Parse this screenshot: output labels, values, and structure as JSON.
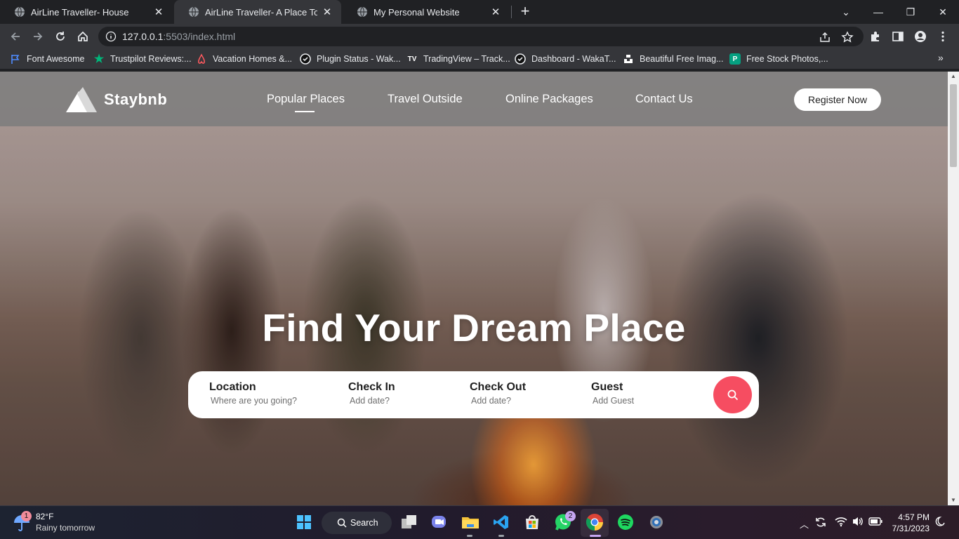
{
  "browser": {
    "tabs": [
      {
        "title": "AirLine Traveller- House",
        "active": false
      },
      {
        "title": "AirLine Traveller- A Place To Choose",
        "active": true
      },
      {
        "title": "My Personal Website",
        "active": false
      }
    ],
    "url_host": "127.0.0.1",
    "url_rest": ":5503/index.html",
    "bookmarks": [
      {
        "label": "Font Awesome",
        "icon": "flag-icon"
      },
      {
        "label": "Trustpilot Reviews:...",
        "icon": "star-icon"
      },
      {
        "label": "Vacation Homes &...",
        "icon": "airbnb-icon"
      },
      {
        "label": "Plugin Status - Wak...",
        "icon": "check-circle-icon"
      },
      {
        "label": "TradingView – Track...",
        "icon": "tradingview-icon"
      },
      {
        "label": "Dashboard - WakaT...",
        "icon": "check-circle-icon"
      },
      {
        "label": "Beautiful Free Imag...",
        "icon": "unsplash-icon"
      },
      {
        "label": "Free Stock Photos,...",
        "icon": "pexels-icon"
      }
    ]
  },
  "site": {
    "brand": "Staybnb",
    "nav": [
      {
        "label": "Popular Places",
        "active": true
      },
      {
        "label": "Travel Outside",
        "active": false
      },
      {
        "label": "Online Packages",
        "active": false
      },
      {
        "label": "Contact Us",
        "active": false
      }
    ],
    "register_label": "Register Now",
    "headline": "Find Your Dream Place",
    "search": {
      "fields": [
        {
          "label": "Location",
          "placeholder": "Where are you going?"
        },
        {
          "label": "Check In",
          "placeholder": "Add date?"
        },
        {
          "label": "Check Out",
          "placeholder": "Add date?"
        },
        {
          "label": "Guest",
          "placeholder": "Add Guest"
        }
      ],
      "accent_color": "#f64d61"
    }
  },
  "taskbar": {
    "weather_temp": "82°F",
    "weather_cond": "Rainy tomorrow",
    "weather_badge": "1",
    "search_label": "Search",
    "whatsapp_badge": "2",
    "time": "4:57 PM",
    "date": "7/31/2023"
  }
}
